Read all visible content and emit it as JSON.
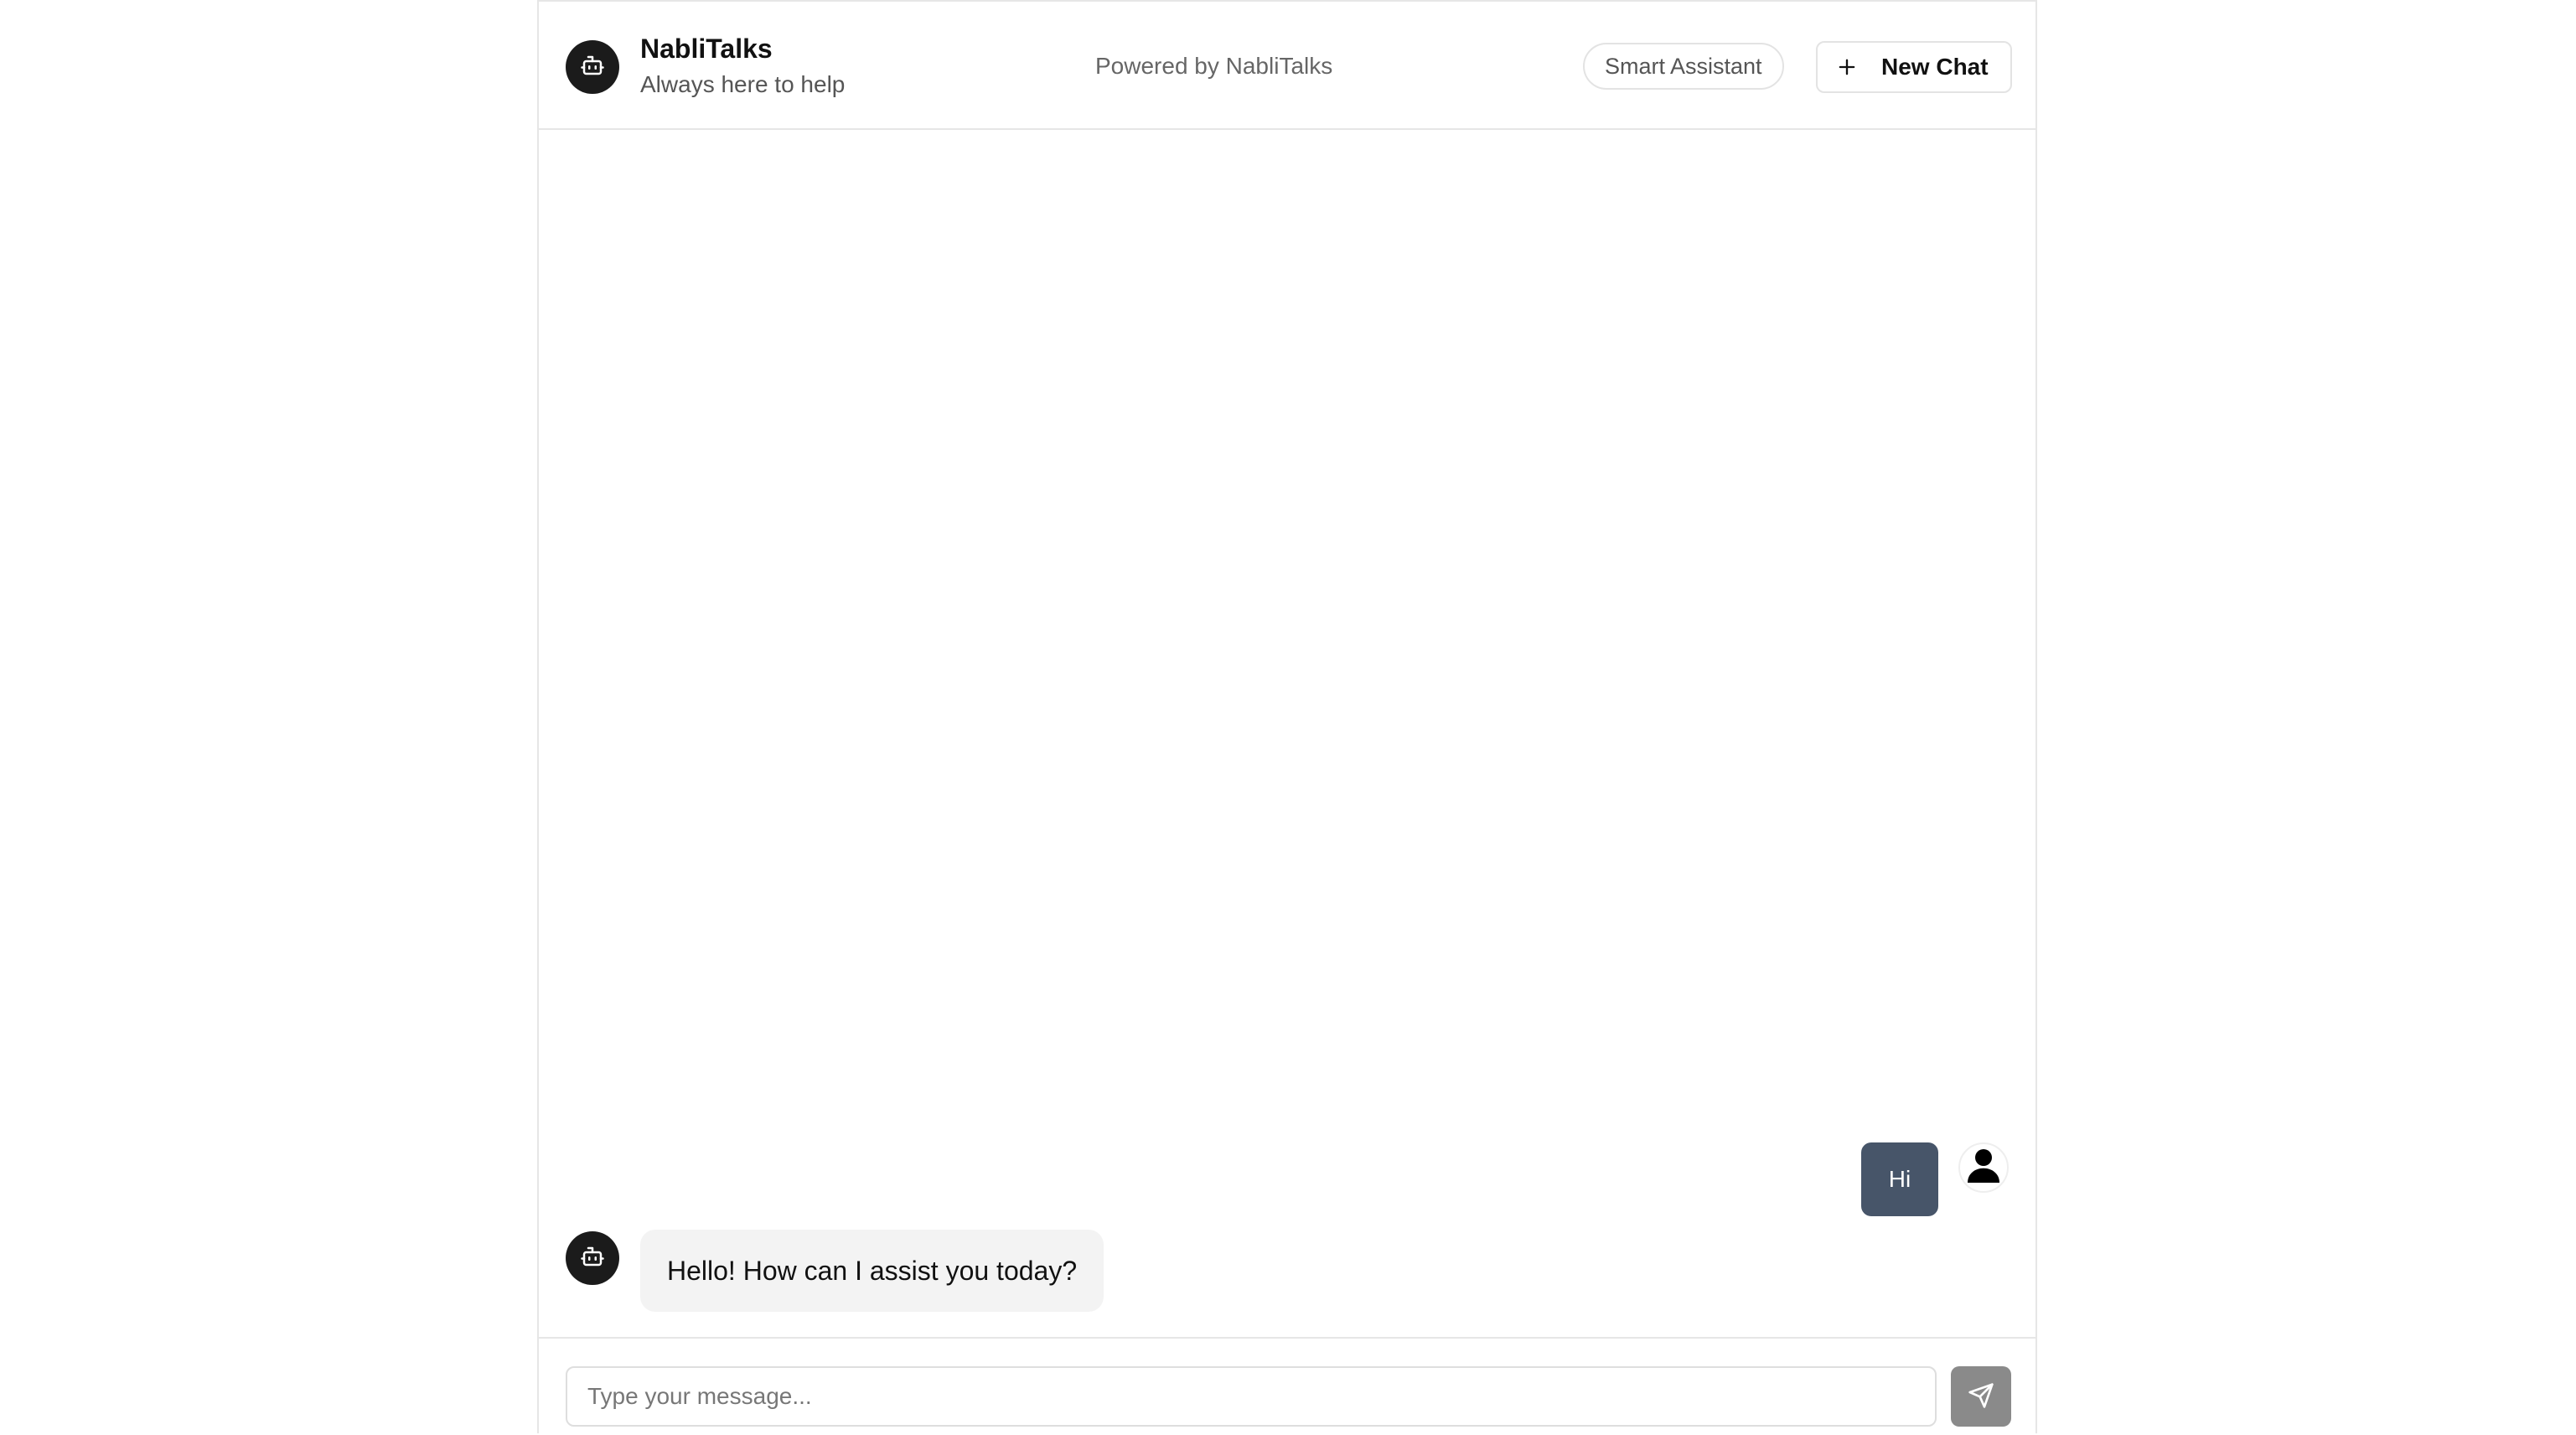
{
  "header": {
    "title": "NabliTalks",
    "subtitle": "Always here to help",
    "powered_by": "Powered by NabliTalks",
    "badge": "Smart Assistant",
    "new_chat_label": "New Chat",
    "avatar_icon": "robot-icon"
  },
  "messages": [
    {
      "role": "user",
      "text": "Hi",
      "avatar_icon": "user-icon"
    },
    {
      "role": "assistant",
      "text": "Hello! How can I assist you today?",
      "avatar_icon": "robot-icon"
    }
  ],
  "composer": {
    "placeholder": "Type your message...",
    "value": "",
    "send_icon": "send-icon"
  },
  "colors": {
    "user_bubble": "#475569",
    "bot_bubble": "#f3f3f3",
    "avatar_bg": "#1b1b1b",
    "send_button": "#8a8a8a"
  }
}
